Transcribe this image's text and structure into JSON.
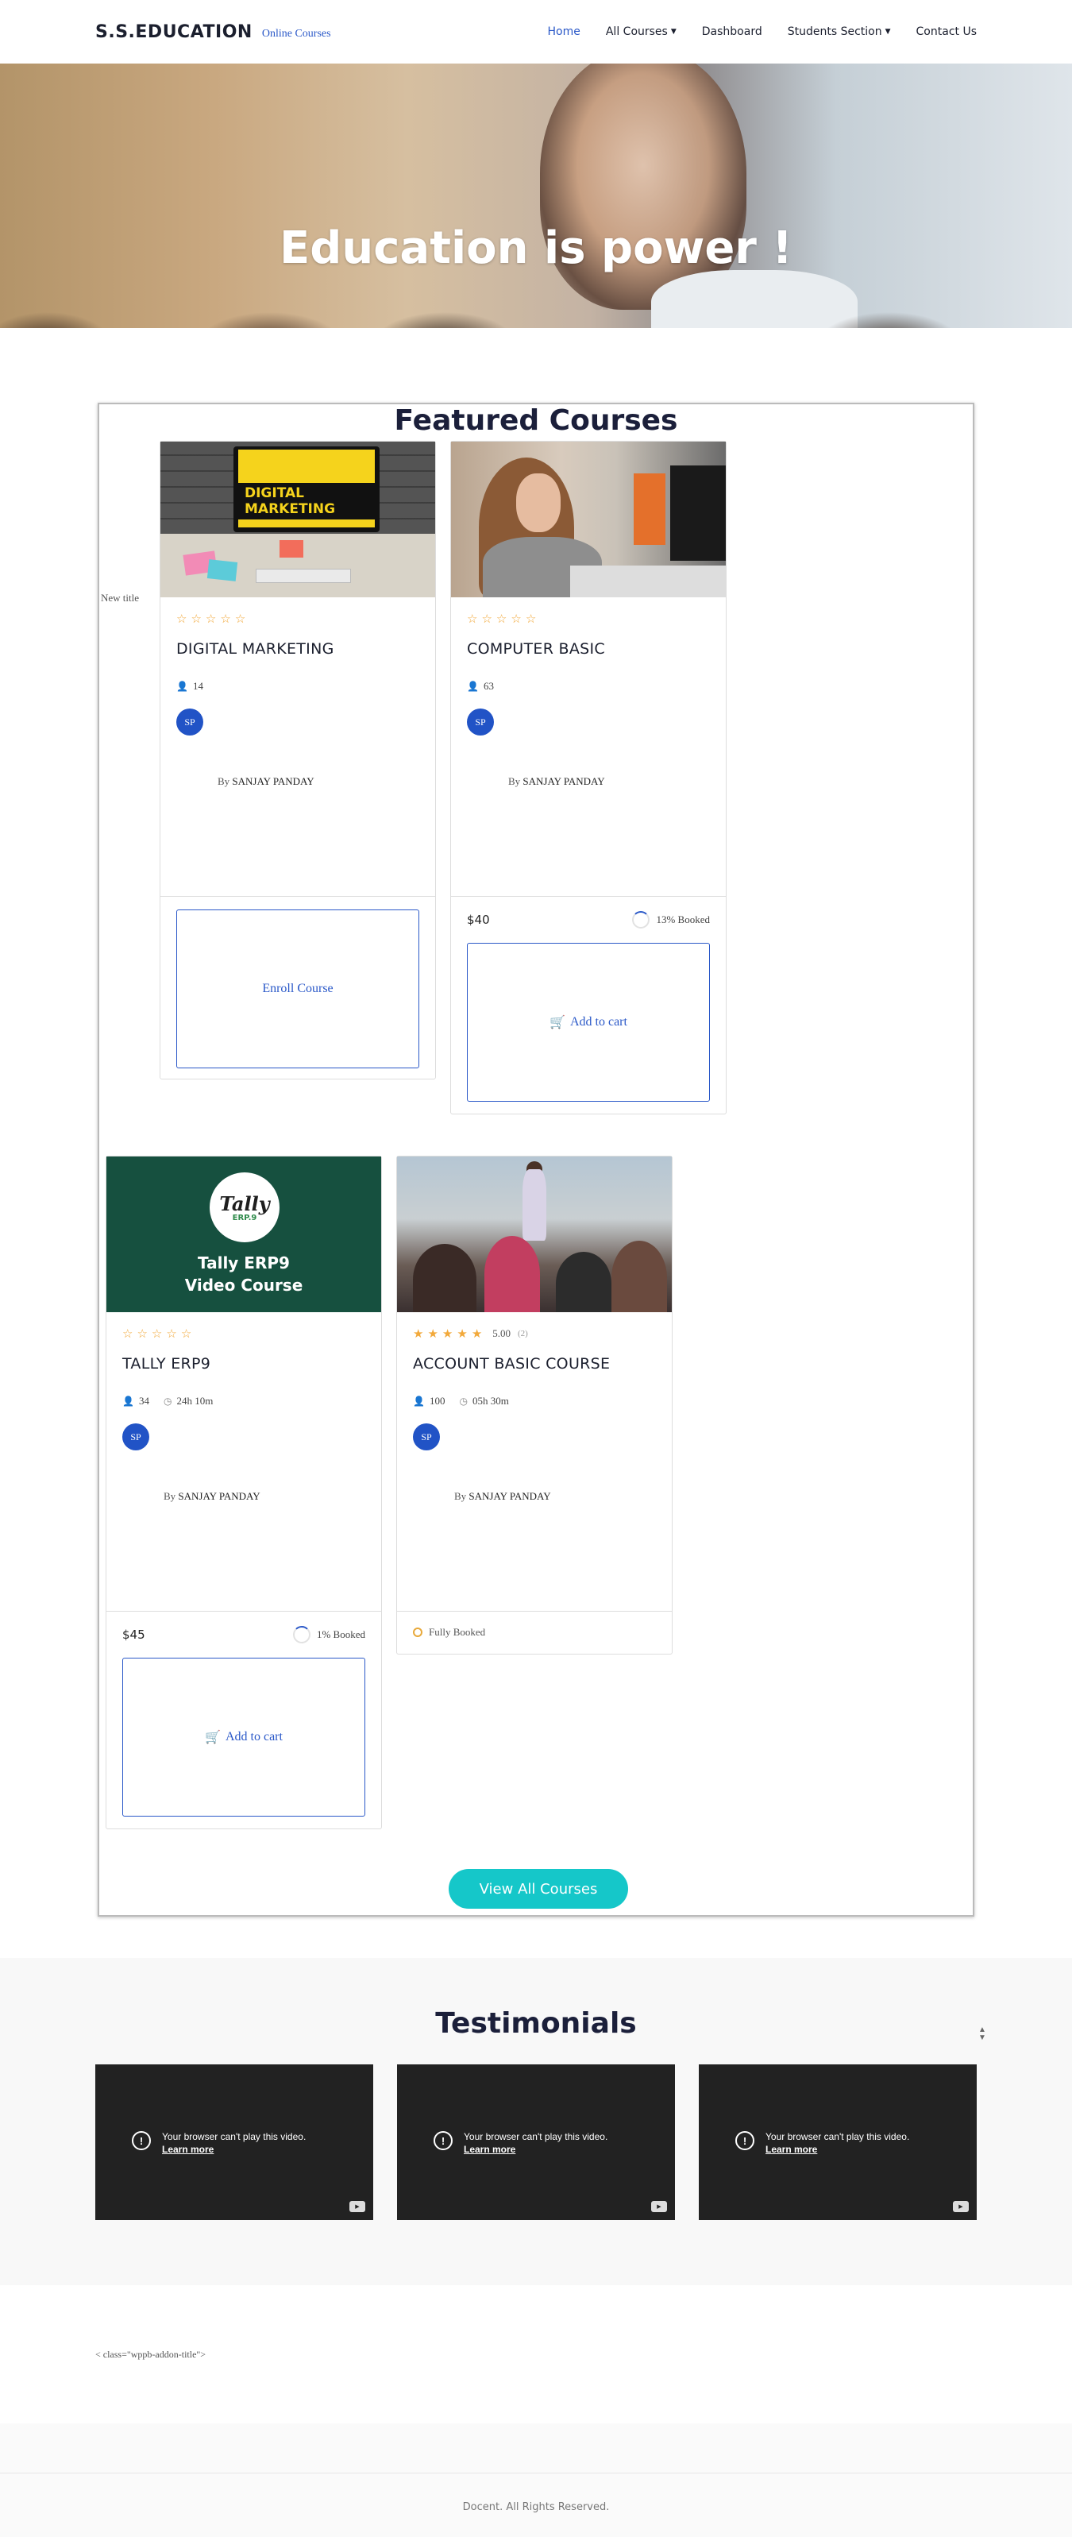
{
  "header": {
    "logo": "S.S.EDUCATION",
    "logo_sub": "Online Courses",
    "nav": [
      {
        "label": "Home",
        "active": true
      },
      {
        "label": "All Courses",
        "dropdown": true
      },
      {
        "label": "Dashboard"
      },
      {
        "label": "Students Section",
        "dropdown": true
      },
      {
        "label": "Contact Us"
      }
    ]
  },
  "hero": {
    "title": "Education is power !"
  },
  "featured": {
    "title": "Featured Courses",
    "new_title": "New title",
    "view_all": "View All Courses",
    "courses": [
      {
        "image_text": "DIGITAL MARKETING",
        "stars_filled": 0,
        "title": "DIGITAL MARKETING",
        "students": "14",
        "avatar": "SP",
        "by": "By",
        "author": "SANJAY PANDAY",
        "button": "Enroll Course"
      },
      {
        "title": "COMPUTER BASIC",
        "stars_filled": 0,
        "students": "63",
        "avatar": "SP",
        "by": "By",
        "author": "SANJAY PANDAY",
        "price": "$40",
        "booked": "13% Booked",
        "button": "Add to cart"
      },
      {
        "image_text_1": "Tally",
        "image_text_2": "ERP.9",
        "image_caption_1": "Tally ERP9",
        "image_caption_2": "Video Course",
        "title": "TALLY ERP9",
        "stars_filled": 0,
        "students": "34",
        "duration": "24h 10m",
        "avatar": "SP",
        "by": "By",
        "author": "SANJAY PANDAY",
        "price": "$45",
        "booked": "1% Booked",
        "button": "Add to cart"
      },
      {
        "title": "ACCOUNT BASIC COURSE",
        "stars_filled": 5,
        "rating": "5.00",
        "rating_count": "(2)",
        "students": "100",
        "duration": "05h 30m",
        "avatar": "SP",
        "by": "By",
        "author": "SANJAY PANDAY",
        "status": "Fully Booked"
      }
    ]
  },
  "testimonials": {
    "title": "Testimonials",
    "video_msg": "Your browser can't play this video.",
    "learn_more": "Learn more"
  },
  "addon": {
    "text": "< class=\"wppb-addon-title\">"
  },
  "footer": {
    "copyright": "Docent. All Rights Reserved."
  },
  "colors": {
    "accent": "#2a58c8",
    "cta_teal": "#15c7c9",
    "star": "#f2a93b",
    "heading": "#1b1f3a"
  }
}
